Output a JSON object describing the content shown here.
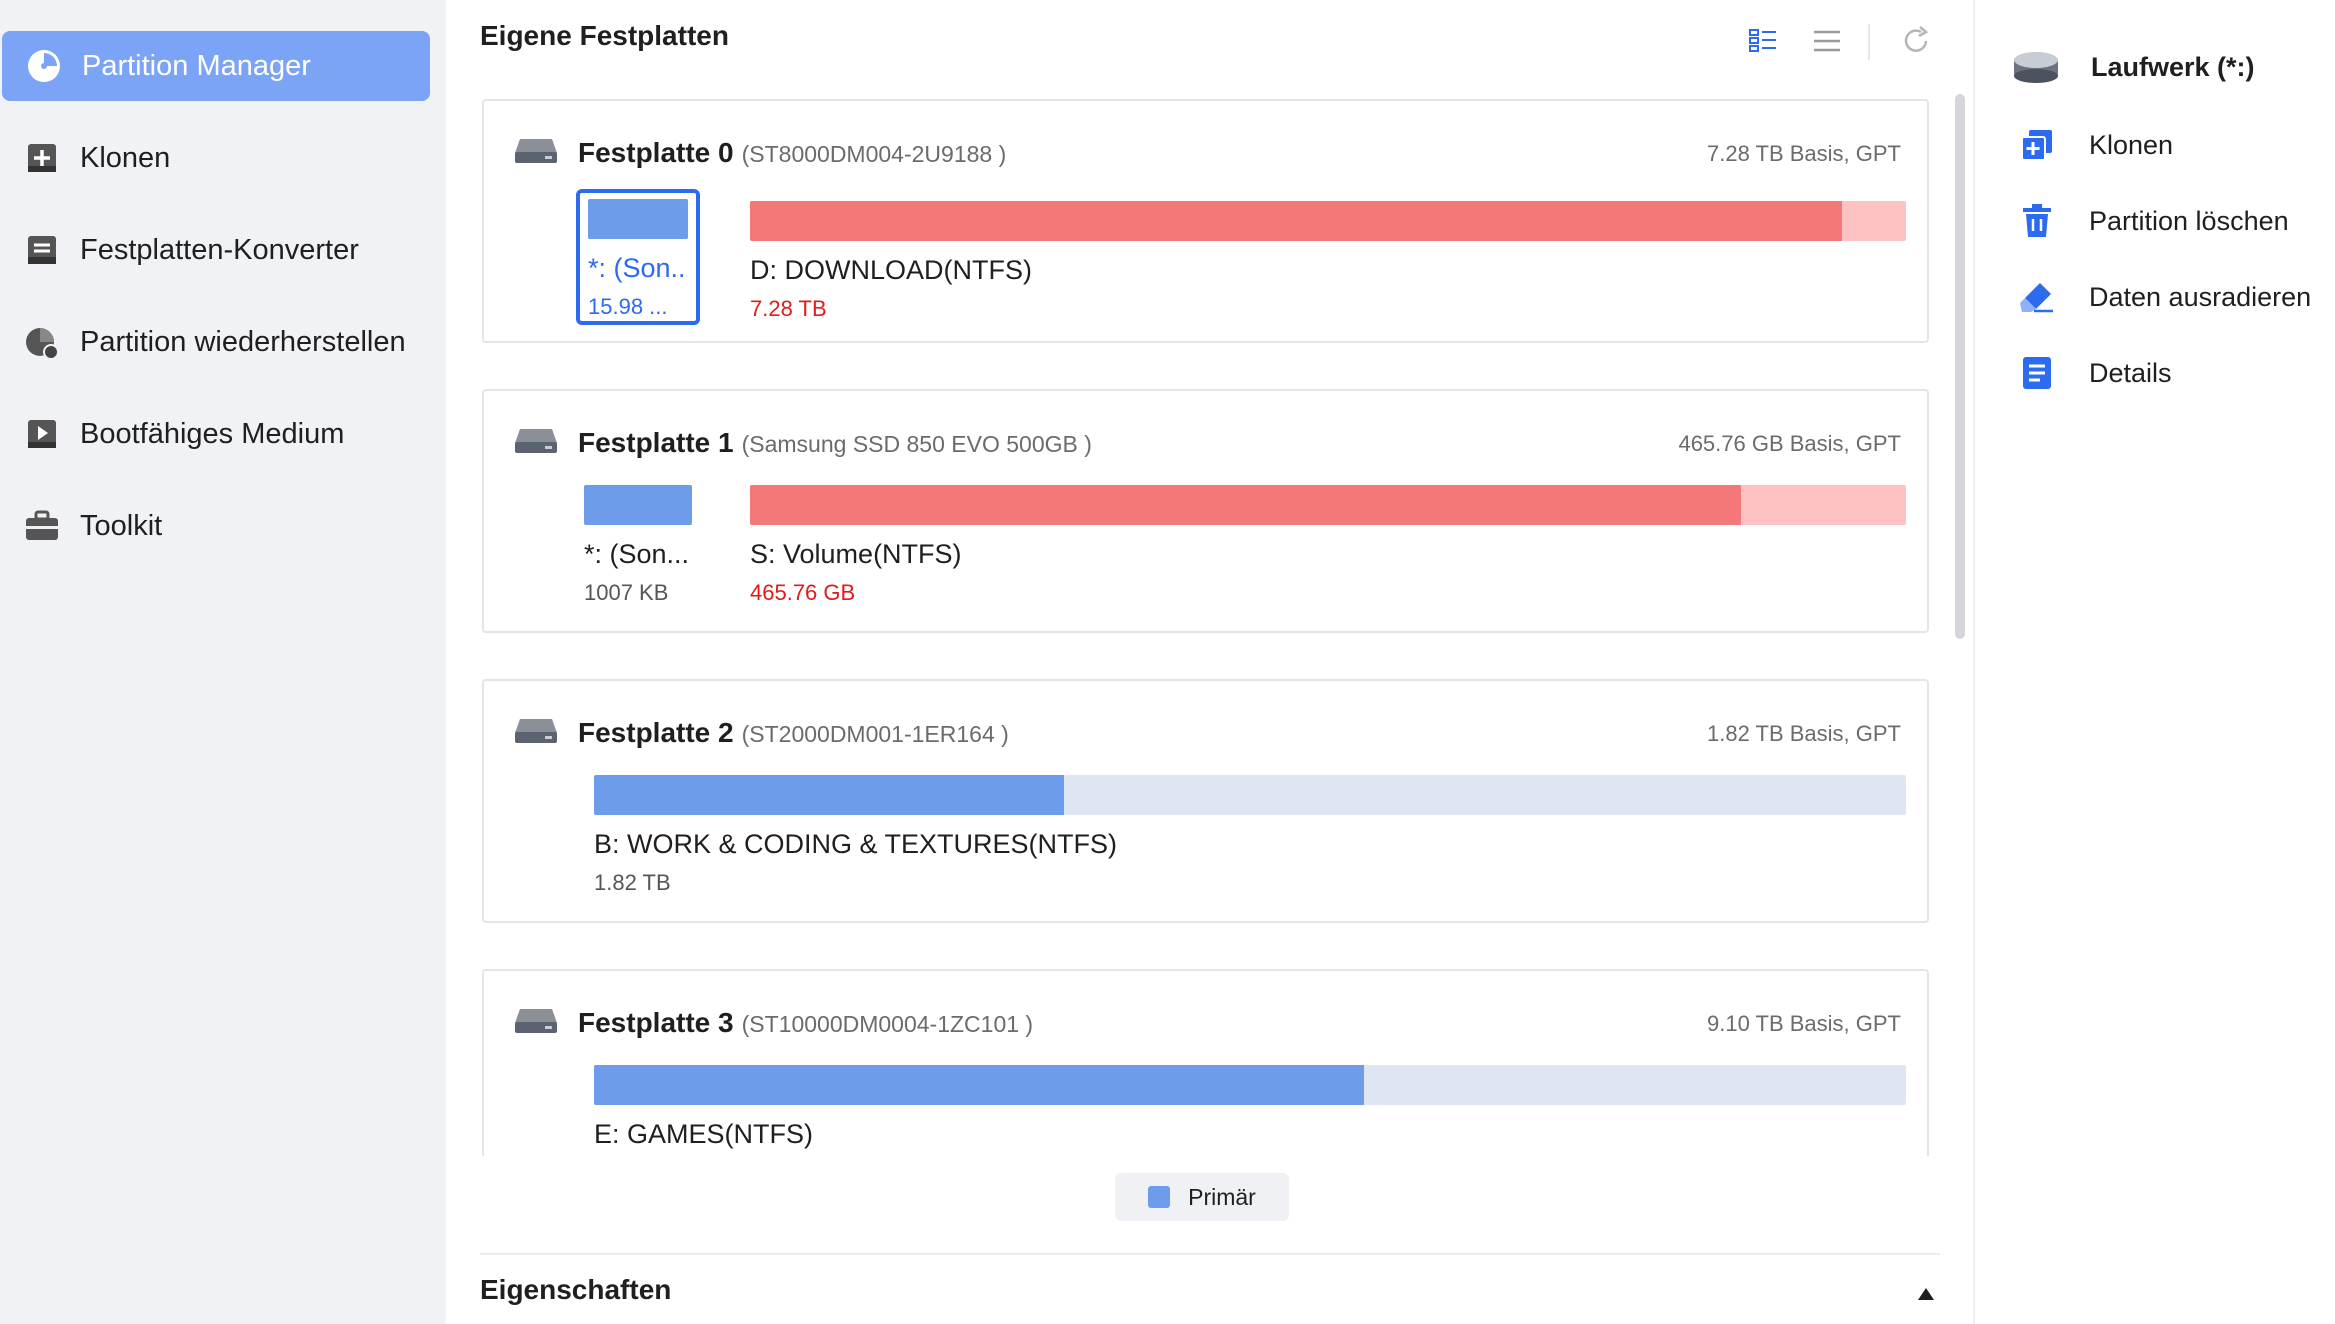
{
  "sidebar": {
    "items": [
      {
        "label": "Partition Manager",
        "icon": "pie-chart-icon",
        "active": true
      },
      {
        "label": "Klonen",
        "icon": "clone-icon"
      },
      {
        "label": "Festplatten-Konverter",
        "icon": "disk-convert-icon"
      },
      {
        "label": "Partition wiederherstellen",
        "icon": "recover-icon"
      },
      {
        "label": "Bootfähiges Medium",
        "icon": "bootable-media-icon"
      },
      {
        "label": "Toolkit",
        "icon": "toolkit-icon"
      }
    ]
  },
  "main": {
    "title": "Eigene Festplatten",
    "toolbar": {
      "grid_view": "grid-view-icon",
      "list_view": "list-view-icon",
      "refresh": "refresh-icon"
    },
    "disks": [
      {
        "name": "Festplatte 0",
        "model": "(ST8000DM004-2U9188 )",
        "info": "7.28 TB Basis, GPT",
        "partitions": [
          {
            "label": "*: (Son...",
            "size": "15.98 ...",
            "fill": 1.0,
            "selected": true
          },
          {
            "label": "D: DOWNLOAD(NTFS)",
            "size": "7.28 TB",
            "fill": 0.945,
            "color": "red"
          }
        ]
      },
      {
        "name": "Festplatte 1",
        "model": "(Samsung SSD 850 EVO 500GB )",
        "info": "465.76 GB Basis, GPT",
        "partitions": [
          {
            "label": "*: (Son...",
            "size": "1007 KB",
            "fill": 1.0
          },
          {
            "label": "S: Volume(NTFS)",
            "size": "465.76 GB",
            "fill": 0.857,
            "color": "red"
          }
        ]
      },
      {
        "name": "Festplatte 2",
        "model": "(ST2000DM001-1ER164 )",
        "info": "1.82 TB Basis, GPT",
        "partitions": [
          {
            "label": "B: WORK & CODING & TEXTURES(NTFS)",
            "size": "1.82 TB",
            "fill": 0.358
          }
        ]
      },
      {
        "name": "Festplatte 3",
        "model": "(ST10000DM0004-1ZC101 )",
        "info": "9.10 TB Basis, GPT",
        "partitions": [
          {
            "label": "E: GAMES(NTFS)",
            "size": "",
            "fill": 0.587
          }
        ]
      }
    ],
    "legend": {
      "label": "Primär",
      "color": "#6d9ceb"
    },
    "properties_title": "Eigenschaften"
  },
  "right_panel": {
    "header": "Laufwerk (*:)",
    "actions": [
      {
        "label": "Klonen",
        "icon": "clone-icon"
      },
      {
        "label": "Partition löschen",
        "icon": "trash-icon"
      },
      {
        "label": "Daten ausradieren",
        "icon": "eraser-icon"
      },
      {
        "label": "Details",
        "icon": "details-icon"
      }
    ]
  }
}
